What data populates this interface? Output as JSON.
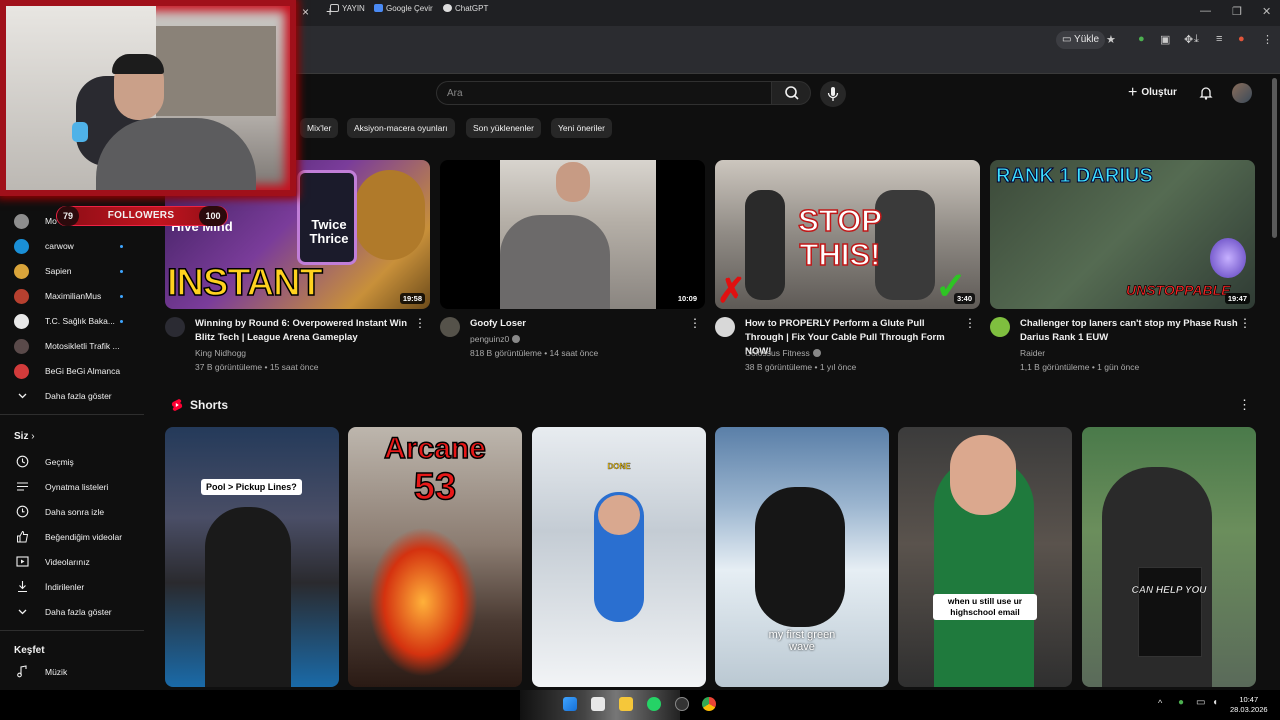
{
  "browser": {
    "tab_close": "×",
    "tab_new": "+",
    "upload_label": "Yükle",
    "bookmarks": [
      {
        "label": "YAYIN",
        "icon": "folder-icon"
      },
      {
        "label": "Google Çevir",
        "icon": "google-translate-icon"
      },
      {
        "label": "ChatGPT",
        "icon": "chatgpt-icon"
      }
    ]
  },
  "header": {
    "search_placeholder": "Ara",
    "create_label": "Oluştur"
  },
  "chips": [
    "Mix'ler",
    "Aksiyon-macera oyunları",
    "Son yüklenenler",
    "Yeni öneriler"
  ],
  "sidebar": {
    "subscriptions": [
      {
        "label": "Mo",
        "color": "#8e8e8e",
        "live": false
      },
      {
        "label": "carwow",
        "color": "#1a8fd6",
        "live": true
      },
      {
        "label": "Sapien",
        "color": "#d9a43a",
        "live": true
      },
      {
        "label": "MaximilianMus",
        "color": "#b7402f",
        "live": true
      },
      {
        "label": "T.C. Sağlık Baka...",
        "color": "#e8e8e8",
        "live": true
      },
      {
        "label": "Motosikletli Trafik ...",
        "color": "#5a4a4a",
        "live": false
      },
      {
        "label": "BeGi BeGi Almanca",
        "color": "#d23b3b",
        "live": false
      }
    ],
    "more_subs": "Daha fazla göster",
    "you_heading": "Siz",
    "you_items": [
      {
        "label": "Geçmiş",
        "icon": "history-icon"
      },
      {
        "label": "Oynatma listeleri",
        "icon": "playlists-icon"
      },
      {
        "label": "Daha sonra izle",
        "icon": "watch-later-icon"
      },
      {
        "label": "Beğendiğim videolar",
        "icon": "like-icon"
      },
      {
        "label": "Videolarınız",
        "icon": "your-videos-icon"
      },
      {
        "label": "İndirilenler",
        "icon": "download-icon"
      },
      {
        "label": "Daha fazla göster",
        "icon": "chevron-down-icon"
      }
    ],
    "explore_heading": "Keşfet",
    "explore_items": [
      {
        "label": "Müzik",
        "icon": "music-icon"
      }
    ]
  },
  "videos": [
    {
      "title": "Winning by Round 6: Overpowered Instant Win Blitz Tech | League Arena Gameplay",
      "channel": "King Nidhogg",
      "verified": false,
      "views": "37 B görüntüleme",
      "age": "15 saat önce",
      "duration": "19:58",
      "thumb_text": "INSTANT WIN",
      "thumb_text2": "Hive Mind",
      "thumb_text3": "Twice Thrice"
    },
    {
      "title": "Goofy Loser",
      "channel": "penguinz0",
      "verified": true,
      "views": "818 B görüntüleme",
      "age": "14 saat önce",
      "duration": "10:09"
    },
    {
      "title": "How to PROPERLY Perform a Glute Pull Through | Fix Your Cable Pull Through Form NOW!",
      "channel": "Colossus Fitness",
      "verified": true,
      "views": "38 B görüntüleme",
      "age": "1 yıl önce",
      "duration": "3:40",
      "thumb_text": "STOP THIS!"
    },
    {
      "title": "Challenger top laners can't stop my Phase Rush Darius Rank 1 EUW",
      "channel": "Raider",
      "verified": false,
      "views": "1,1 B görüntüleme",
      "age": "1 gün önce",
      "duration": "19:47",
      "thumb_text": "RANK 1 DARIUS",
      "thumb_text2": "UNSTOPPABLE"
    }
  ],
  "shorts": {
    "heading": "Shorts",
    "items": [
      {
        "caption": "Pool > Pickup Lines?"
      },
      {
        "caption": "Arcane",
        "caption2": "53"
      },
      {
        "caption": "DONE"
      },
      {
        "caption": "my first green wave"
      },
      {
        "caption": "when u still use ur highschool email"
      },
      {
        "caption": "CAN HELP YOU"
      }
    ]
  },
  "overlay": {
    "followers_label": "FOLLOWERS",
    "followers_current": "79",
    "followers_goal": "100"
  },
  "taskbar": {
    "time": "10:47",
    "date": "28.03.2026"
  }
}
